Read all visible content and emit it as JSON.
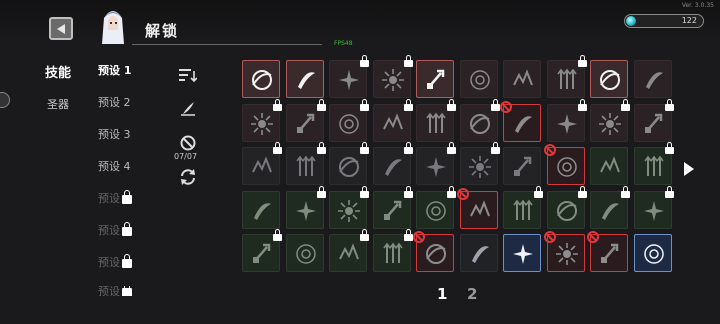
{
  "header": {
    "title": "解锁",
    "fps": "FPS48",
    "version": "Ver. 3.0.35"
  },
  "currency": {
    "value": "122",
    "icon": "gem-icon"
  },
  "tabs": [
    {
      "label": "技能",
      "active": true
    },
    {
      "label": "圣器",
      "active": false
    }
  ],
  "presets": [
    {
      "label": "预设 1",
      "locked": false
    },
    {
      "label": "预设 2",
      "locked": false
    },
    {
      "label": "预设 3",
      "locked": false
    },
    {
      "label": "预设 4",
      "locked": false
    },
    {
      "label": "预设",
      "locked": true
    },
    {
      "label": "预设",
      "locked": true
    },
    {
      "label": "预设",
      "locked": true
    },
    {
      "label": "预设",
      "locked": true
    }
  ],
  "toolbar": {
    "slot_count": "07/07",
    "icons": [
      "sort-icon",
      "quill-icon",
      "ban-icon",
      "refresh-icon"
    ]
  },
  "grid": {
    "rows": [
      [
        {
          "t": "w",
          "lock": false,
          "ban": false
        },
        {
          "t": "w",
          "lock": false,
          "ban": false
        },
        {
          "t": "r",
          "lock": true,
          "ban": false
        },
        {
          "t": "r",
          "lock": true,
          "ban": false
        },
        {
          "t": "w",
          "lock": false,
          "ban": false
        },
        {
          "t": "r",
          "lock": false,
          "ban": false
        },
        {
          "t": "r",
          "lock": false,
          "ban": false
        },
        {
          "t": "r",
          "lock": true,
          "ban": false
        },
        {
          "t": "w",
          "lock": false,
          "ban": false
        },
        {
          "t": "r",
          "lock": false,
          "ban": false
        }
      ],
      [
        {
          "t": "r",
          "lock": true,
          "ban": false
        },
        {
          "t": "r",
          "lock": true,
          "ban": false
        },
        {
          "t": "r",
          "lock": true,
          "ban": false
        },
        {
          "t": "r",
          "lock": true,
          "ban": false
        },
        {
          "t": "r",
          "lock": true,
          "ban": false
        },
        {
          "t": "r",
          "lock": true,
          "ban": false
        },
        {
          "t": "rs",
          "lock": false,
          "ban": true
        },
        {
          "t": "r",
          "lock": true,
          "ban": false
        },
        {
          "t": "r",
          "lock": true,
          "ban": false
        },
        {
          "t": "r",
          "lock": true,
          "ban": false
        }
      ],
      [
        {
          "t": "n",
          "lock": true,
          "ban": false
        },
        {
          "t": "n",
          "lock": true,
          "ban": false
        },
        {
          "t": "n",
          "lock": true,
          "ban": false
        },
        {
          "t": "n",
          "lock": true,
          "ban": false
        },
        {
          "t": "n",
          "lock": true,
          "ban": false
        },
        {
          "t": "n",
          "lock": true,
          "ban": false
        },
        {
          "t": "n",
          "lock": false,
          "ban": false
        },
        {
          "t": "rs",
          "lock": false,
          "ban": true
        },
        {
          "t": "g",
          "lock": false,
          "ban": false
        },
        {
          "t": "g",
          "lock": true,
          "ban": false
        }
      ],
      [
        {
          "t": "g",
          "lock": false,
          "ban": false
        },
        {
          "t": "g",
          "lock": true,
          "ban": false
        },
        {
          "t": "g",
          "lock": true,
          "ban": false
        },
        {
          "t": "g",
          "lock": true,
          "ban": false
        },
        {
          "t": "g",
          "lock": true,
          "ban": false
        },
        {
          "t": "rs",
          "lock": false,
          "ban": true
        },
        {
          "t": "g",
          "lock": true,
          "ban": false
        },
        {
          "t": "g",
          "lock": true,
          "ban": false
        },
        {
          "t": "g",
          "lock": true,
          "ban": false
        },
        {
          "t": "g",
          "lock": true,
          "ban": false
        }
      ],
      [
        {
          "t": "g",
          "lock": true,
          "ban": false
        },
        {
          "t": "g",
          "lock": false,
          "ban": false
        },
        {
          "t": "g",
          "lock": true,
          "ban": false
        },
        {
          "t": "g",
          "lock": true,
          "ban": false
        },
        {
          "t": "rs",
          "lock": false,
          "ban": true
        },
        {
          "t": "d",
          "lock": false,
          "ban": false
        },
        {
          "t": "b",
          "lock": false,
          "ban": false
        },
        {
          "t": "rs",
          "lock": false,
          "ban": true
        },
        {
          "t": "rs",
          "lock": false,
          "ban": true
        },
        {
          "t": "b",
          "lock": false,
          "ban": false
        }
      ]
    ]
  },
  "pagination": {
    "pages": [
      "1",
      "2"
    ],
    "current": "1"
  },
  "colors": {
    "accent_red": "#d23a3a",
    "accent_blue": "#6f8fc8",
    "lock": "#ffffff",
    "currency_gem": "#1ab2c8"
  }
}
